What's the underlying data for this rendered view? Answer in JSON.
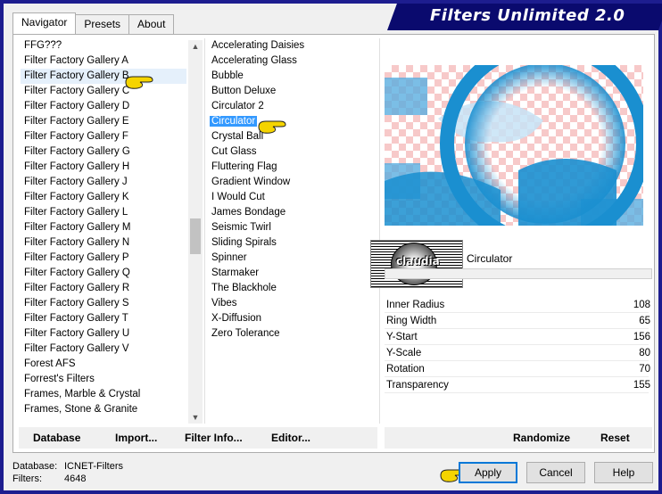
{
  "app": {
    "title": "Filters Unlimited 2.0"
  },
  "tabs": [
    {
      "label": "Navigator"
    },
    {
      "label": "Presets"
    },
    {
      "label": "About"
    }
  ],
  "categories": [
    "FFG???",
    "Filter Factory Gallery A",
    "Filter Factory Gallery B",
    "Filter Factory Gallery C",
    "Filter Factory Gallery D",
    "Filter Factory Gallery E",
    "Filter Factory Gallery F",
    "Filter Factory Gallery G",
    "Filter Factory Gallery H",
    "Filter Factory Gallery J",
    "Filter Factory Gallery K",
    "Filter Factory Gallery L",
    "Filter Factory Gallery M",
    "Filter Factory Gallery N",
    "Filter Factory Gallery P",
    "Filter Factory Gallery Q",
    "Filter Factory Gallery R",
    "Filter Factory Gallery S",
    "Filter Factory Gallery T",
    "Filter Factory Gallery U",
    "Filter Factory Gallery V",
    "Forest AFS",
    "Forrest's Filters",
    "Frames, Marble & Crystal",
    "Frames, Stone & Granite"
  ],
  "selected_category": "Filter Factory Gallery B",
  "filters": [
    "Accelerating Daisies",
    "Accelerating Glass",
    "Bubble",
    "Button Deluxe",
    "Circulator 2",
    "Circulator",
    "Crystal Ball",
    "Cut Glass",
    "Fluttering Flag",
    "Gradient Window",
    "I Would Cut",
    "James Bondage",
    "Seismic Twirl",
    "Sliding Spirals",
    "Spinner",
    "Starmaker",
    "The Blackhole",
    "Vibes",
    "X-Diffusion",
    "Zero Tolerance"
  ],
  "selected_filter": "Circulator",
  "logo": {
    "text": "claudia"
  },
  "current_filter_name": "Circulator",
  "params": [
    {
      "label": "Inner Radius",
      "value": "108"
    },
    {
      "label": "Ring Width",
      "value": "65"
    },
    {
      "label": "Y-Start",
      "value": "156"
    },
    {
      "label": "Y-Scale",
      "value": "80"
    },
    {
      "label": "Rotation",
      "value": "70"
    },
    {
      "label": "Transparency",
      "value": "155"
    }
  ],
  "left_buttons": {
    "database": "Database",
    "import": "Import...",
    "filter_info": "Filter Info...",
    "editor": "Editor..."
  },
  "right_buttons": {
    "randomize": "Randomize",
    "reset": "Reset"
  },
  "status": {
    "database_label": "Database:",
    "database_value": "ICNET-Filters",
    "filters_label": "Filters:",
    "filters_value": "4648"
  },
  "dialog_buttons": {
    "apply": "Apply",
    "cancel": "Cancel",
    "help": "Help"
  },
  "colors": {
    "accent": "#3399ff",
    "preview_blue": "#1a8fd0",
    "checker_pink": "#f7c9c9",
    "title_bg": "#0a0a6e",
    "pointer_yellow": "#f5d400"
  }
}
